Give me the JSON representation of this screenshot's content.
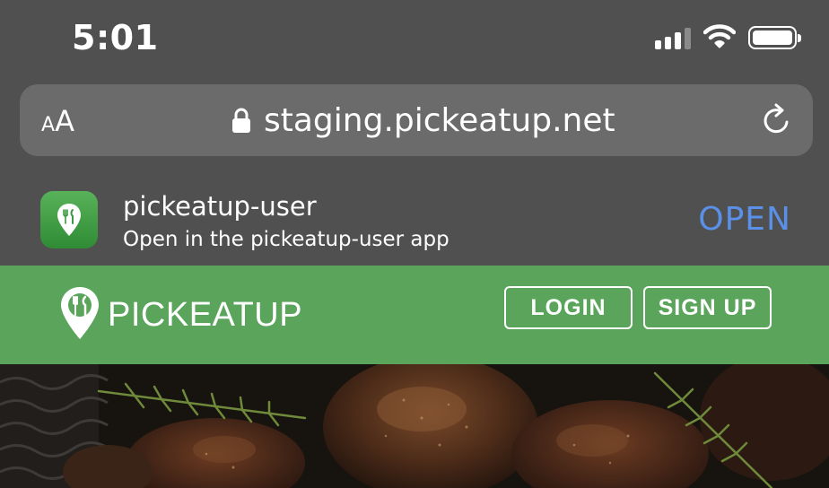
{
  "status_bar": {
    "time": "5:01"
  },
  "browser": {
    "text_size_small": "A",
    "text_size_big": "A",
    "url": "staging.pickeatup.net"
  },
  "app_banner": {
    "app_name": "pickeatup-user",
    "subtitle": "Open in the pickeatup-user app",
    "open_label": "OPEN"
  },
  "site_header": {
    "logo_text": "PICKEATUP",
    "login_label": "LOGIN",
    "signup_label": "SIGN UP"
  },
  "colors": {
    "header_green": "#5aa55b",
    "open_blue": "#5a90e8",
    "chrome_gray": "#505050"
  },
  "icons": [
    "signal-icon",
    "wifi-icon",
    "battery-icon",
    "lock-icon",
    "reload-icon",
    "pickeatup-app-icon",
    "pickeatup-logo-pin-icon"
  ]
}
